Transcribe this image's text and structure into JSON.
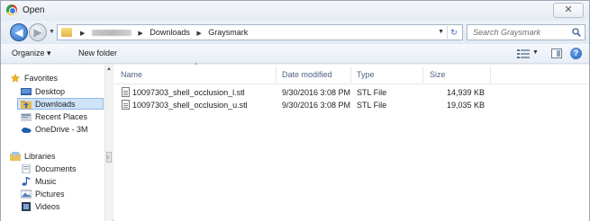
{
  "window": {
    "title": "Open",
    "close_glyph": "✕"
  },
  "address_bar": {
    "back_glyph": "◀",
    "forward_glyph": "▶",
    "crumbs": [
      "Downloads",
      "Graysmark"
    ],
    "refresh_glyph": "↻"
  },
  "search": {
    "placeholder": "Search Graysmark"
  },
  "toolbar": {
    "organize_label": "Organize ▾",
    "new_folder_label": "New folder"
  },
  "nav": {
    "favorites_label": "Favorites",
    "favorites": [
      "Desktop",
      "Downloads",
      "Recent Places",
      "OneDrive - 3M"
    ],
    "selected": "Downloads",
    "libraries_label": "Libraries",
    "libraries": [
      "Documents",
      "Music",
      "Pictures",
      "Videos"
    ]
  },
  "columns": {
    "name": "Name",
    "date": "Date modified",
    "type": "Type",
    "size": "Size"
  },
  "files": [
    {
      "name": "10097303_shell_occlusion_l.stl",
      "date": "9/30/2016 3:08 PM",
      "type": "STL File",
      "size": "14,939 KB"
    },
    {
      "name": "10097303_shell_occlusion_u.stl",
      "date": "9/30/2016 3:08 PM",
      "type": "STL File",
      "size": "19,035 KB"
    }
  ]
}
